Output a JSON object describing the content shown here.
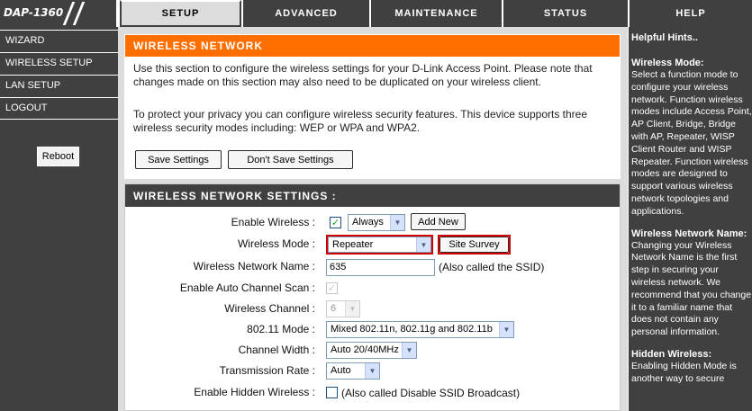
{
  "logo": {
    "model": "DAP-1360"
  },
  "tabs": [
    {
      "label": "SETUP"
    },
    {
      "label": "ADVANCED"
    },
    {
      "label": "MAINTENANCE"
    },
    {
      "label": "STATUS"
    },
    {
      "label": "HELP"
    }
  ],
  "sidebar": {
    "items": [
      {
        "label": "WIZARD"
      },
      {
        "label": "WIRELESS SETUP"
      },
      {
        "label": "LAN SETUP"
      },
      {
        "label": "LOGOUT"
      }
    ],
    "reboot_label": "Reboot"
  },
  "intro": {
    "title": "WIRELESS NETWORK",
    "para1": "Use this section to configure the wireless settings for your D-Link Access Point. Please note that changes made on this section may also need to be duplicated on your wireless client.",
    "para2": "To protect your privacy you can configure wireless security features. This device supports three wireless security modes including: WEP or WPA and WPA2.",
    "save_label": "Save Settings",
    "dont_save_label": "Don't Save Settings"
  },
  "settings": {
    "title": "WIRELESS NETWORK SETTINGS :",
    "enable_wireless": {
      "label": "Enable Wireless :",
      "checked": true,
      "schedule": "Always",
      "add_new": "Add New"
    },
    "mode": {
      "label": "Wireless Mode :",
      "value": "Repeater",
      "site_survey": "Site Survey"
    },
    "ssid": {
      "label": "Wireless Network Name :",
      "value": "635",
      "note": "(Also called the SSID)"
    },
    "auto_channel": {
      "label": "Enable Auto Channel Scan :",
      "checked": true
    },
    "channel": {
      "label": "Wireless Channel :",
      "value": "6"
    },
    "dot11_mode": {
      "label": "802.11 Mode :",
      "value": "Mixed 802.11n, 802.11g and 802.11b"
    },
    "channel_width": {
      "label": "Channel Width :",
      "value": "Auto 20/40MHz"
    },
    "tx_rate": {
      "label": "Transmission Rate :",
      "value": "Auto"
    },
    "hidden": {
      "label": "Enable Hidden Wireless :",
      "checked": false,
      "note": "(Also called Disable SSID Broadcast)"
    }
  },
  "help": {
    "title": "Helpful Hints..",
    "h1": "Wireless Mode:",
    "p1": "Select a function mode to configure your wireless network. Function wireless modes include Access Point, AP Client, Bridge, Bridge with AP, Repeater, WISP Client Router and WISP Repeater. Function wireless modes are designed to support various wireless network topologies and applications.",
    "h2": "Wireless Network Name:",
    "p2": "Changing your Wireless Network Name is the first step in securing your wireless network. We recommend that you change it to a familiar name that does not contain any personal information.",
    "h3": "Hidden Wireless:",
    "p3": "Enabling Hidden Mode is another way to secure"
  },
  "colors": {
    "accent": "#ff6f00",
    "dark": "#404040",
    "panel": "#dcdcdc",
    "highlight": "#d10000"
  }
}
